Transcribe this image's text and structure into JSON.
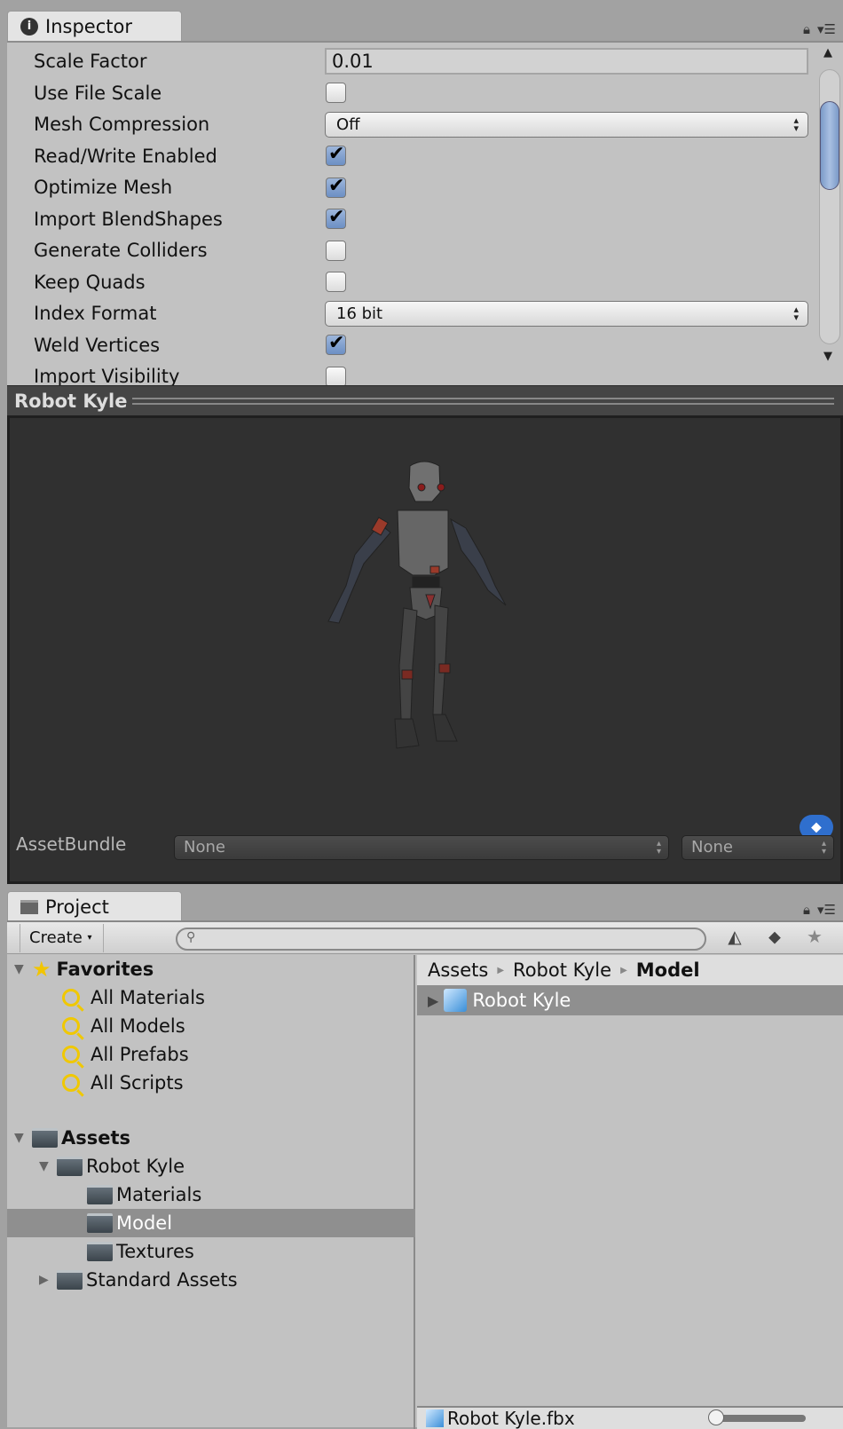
{
  "inspector": {
    "tab_label": "Inspector",
    "rows": [
      {
        "label": "Scale Factor",
        "type": "field",
        "value": "0.01"
      },
      {
        "label": "Use File Scale",
        "type": "checkbox",
        "checked": false
      },
      {
        "label": "Mesh Compression",
        "type": "dropdown",
        "value": "Off"
      },
      {
        "label": "Read/Write Enabled",
        "type": "checkbox",
        "checked": true
      },
      {
        "label": "Optimize Mesh",
        "type": "checkbox",
        "checked": true
      },
      {
        "label": "Import BlendShapes",
        "type": "checkbox",
        "checked": true
      },
      {
        "label": "Generate Colliders",
        "type": "checkbox",
        "checked": false
      },
      {
        "label": "Keep Quads",
        "type": "checkbox",
        "checked": false
      },
      {
        "label": "Index Format",
        "type": "dropdown",
        "value": "16 bit"
      },
      {
        "label": "Weld Vertices",
        "type": "checkbox",
        "checked": true
      },
      {
        "label": "Import Visibility",
        "type": "checkbox",
        "checked": false
      }
    ]
  },
  "preview": {
    "title": "Robot Kyle",
    "assetbundle_label": "AssetBundle",
    "bundle_name": "None",
    "bundle_variant": "None"
  },
  "project": {
    "tab_label": "Project",
    "create_label": "Create",
    "search_placeholder": "",
    "favorites": {
      "label": "Favorites",
      "items": [
        "All Materials",
        "All Models",
        "All Prefabs",
        "All Scripts"
      ]
    },
    "assets": {
      "label": "Assets",
      "robot_kyle": "Robot Kyle",
      "children": [
        "Materials",
        "Model",
        "Textures"
      ],
      "standard_assets": "Standard Assets",
      "selected": "Model"
    },
    "breadcrumb": [
      "Assets",
      "Robot Kyle",
      "Model"
    ],
    "files": [
      {
        "name": "Robot Kyle"
      }
    ],
    "status_file": "Robot Kyle.fbx",
    "zoom_slider": 0
  }
}
